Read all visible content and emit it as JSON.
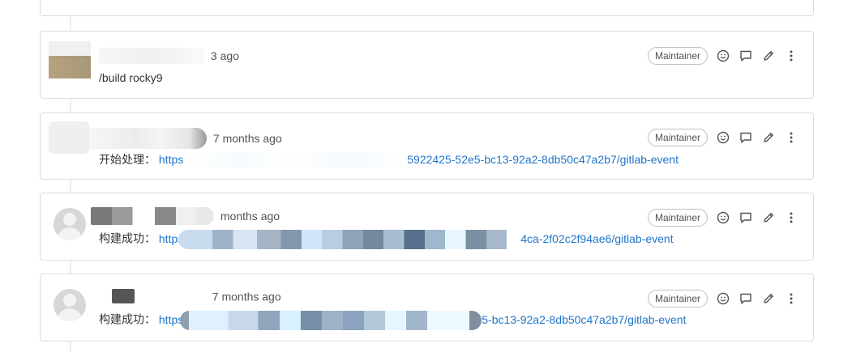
{
  "notes": [
    {
      "time": "3 ago",
      "role": "Maintainer",
      "body_prefix": "/build rocky9",
      "link_start": "",
      "link_end": ""
    },
    {
      "time": "7 months ago",
      "role": "Maintainer",
      "body_prefix": "开始处理：",
      "link_start": "https",
      "link_end": "5922425-52e5-bc13-92a2-8db50c47a2b7/gitlab-event"
    },
    {
      "time": "months ago",
      "role": "Maintainer",
      "body_prefix": "构建成功：",
      "link_start": "https",
      "link_end": "4ca-2f02c2f94ae6/gitlab-event"
    },
    {
      "time": "7 months ago",
      "role": "Maintainer",
      "body_prefix": "构建成功：",
      "link_start": "https",
      "link_end": "5-bc13-92a2-8db50c47a2b7/gitlab-event"
    }
  ],
  "icons": {
    "emoji": "smiley-icon",
    "reply": "comment-icon",
    "edit": "pencil-icon",
    "more": "vertical-ellipsis-icon"
  },
  "colors": {
    "link": "#1f75cb",
    "border": "#dcdcde"
  }
}
